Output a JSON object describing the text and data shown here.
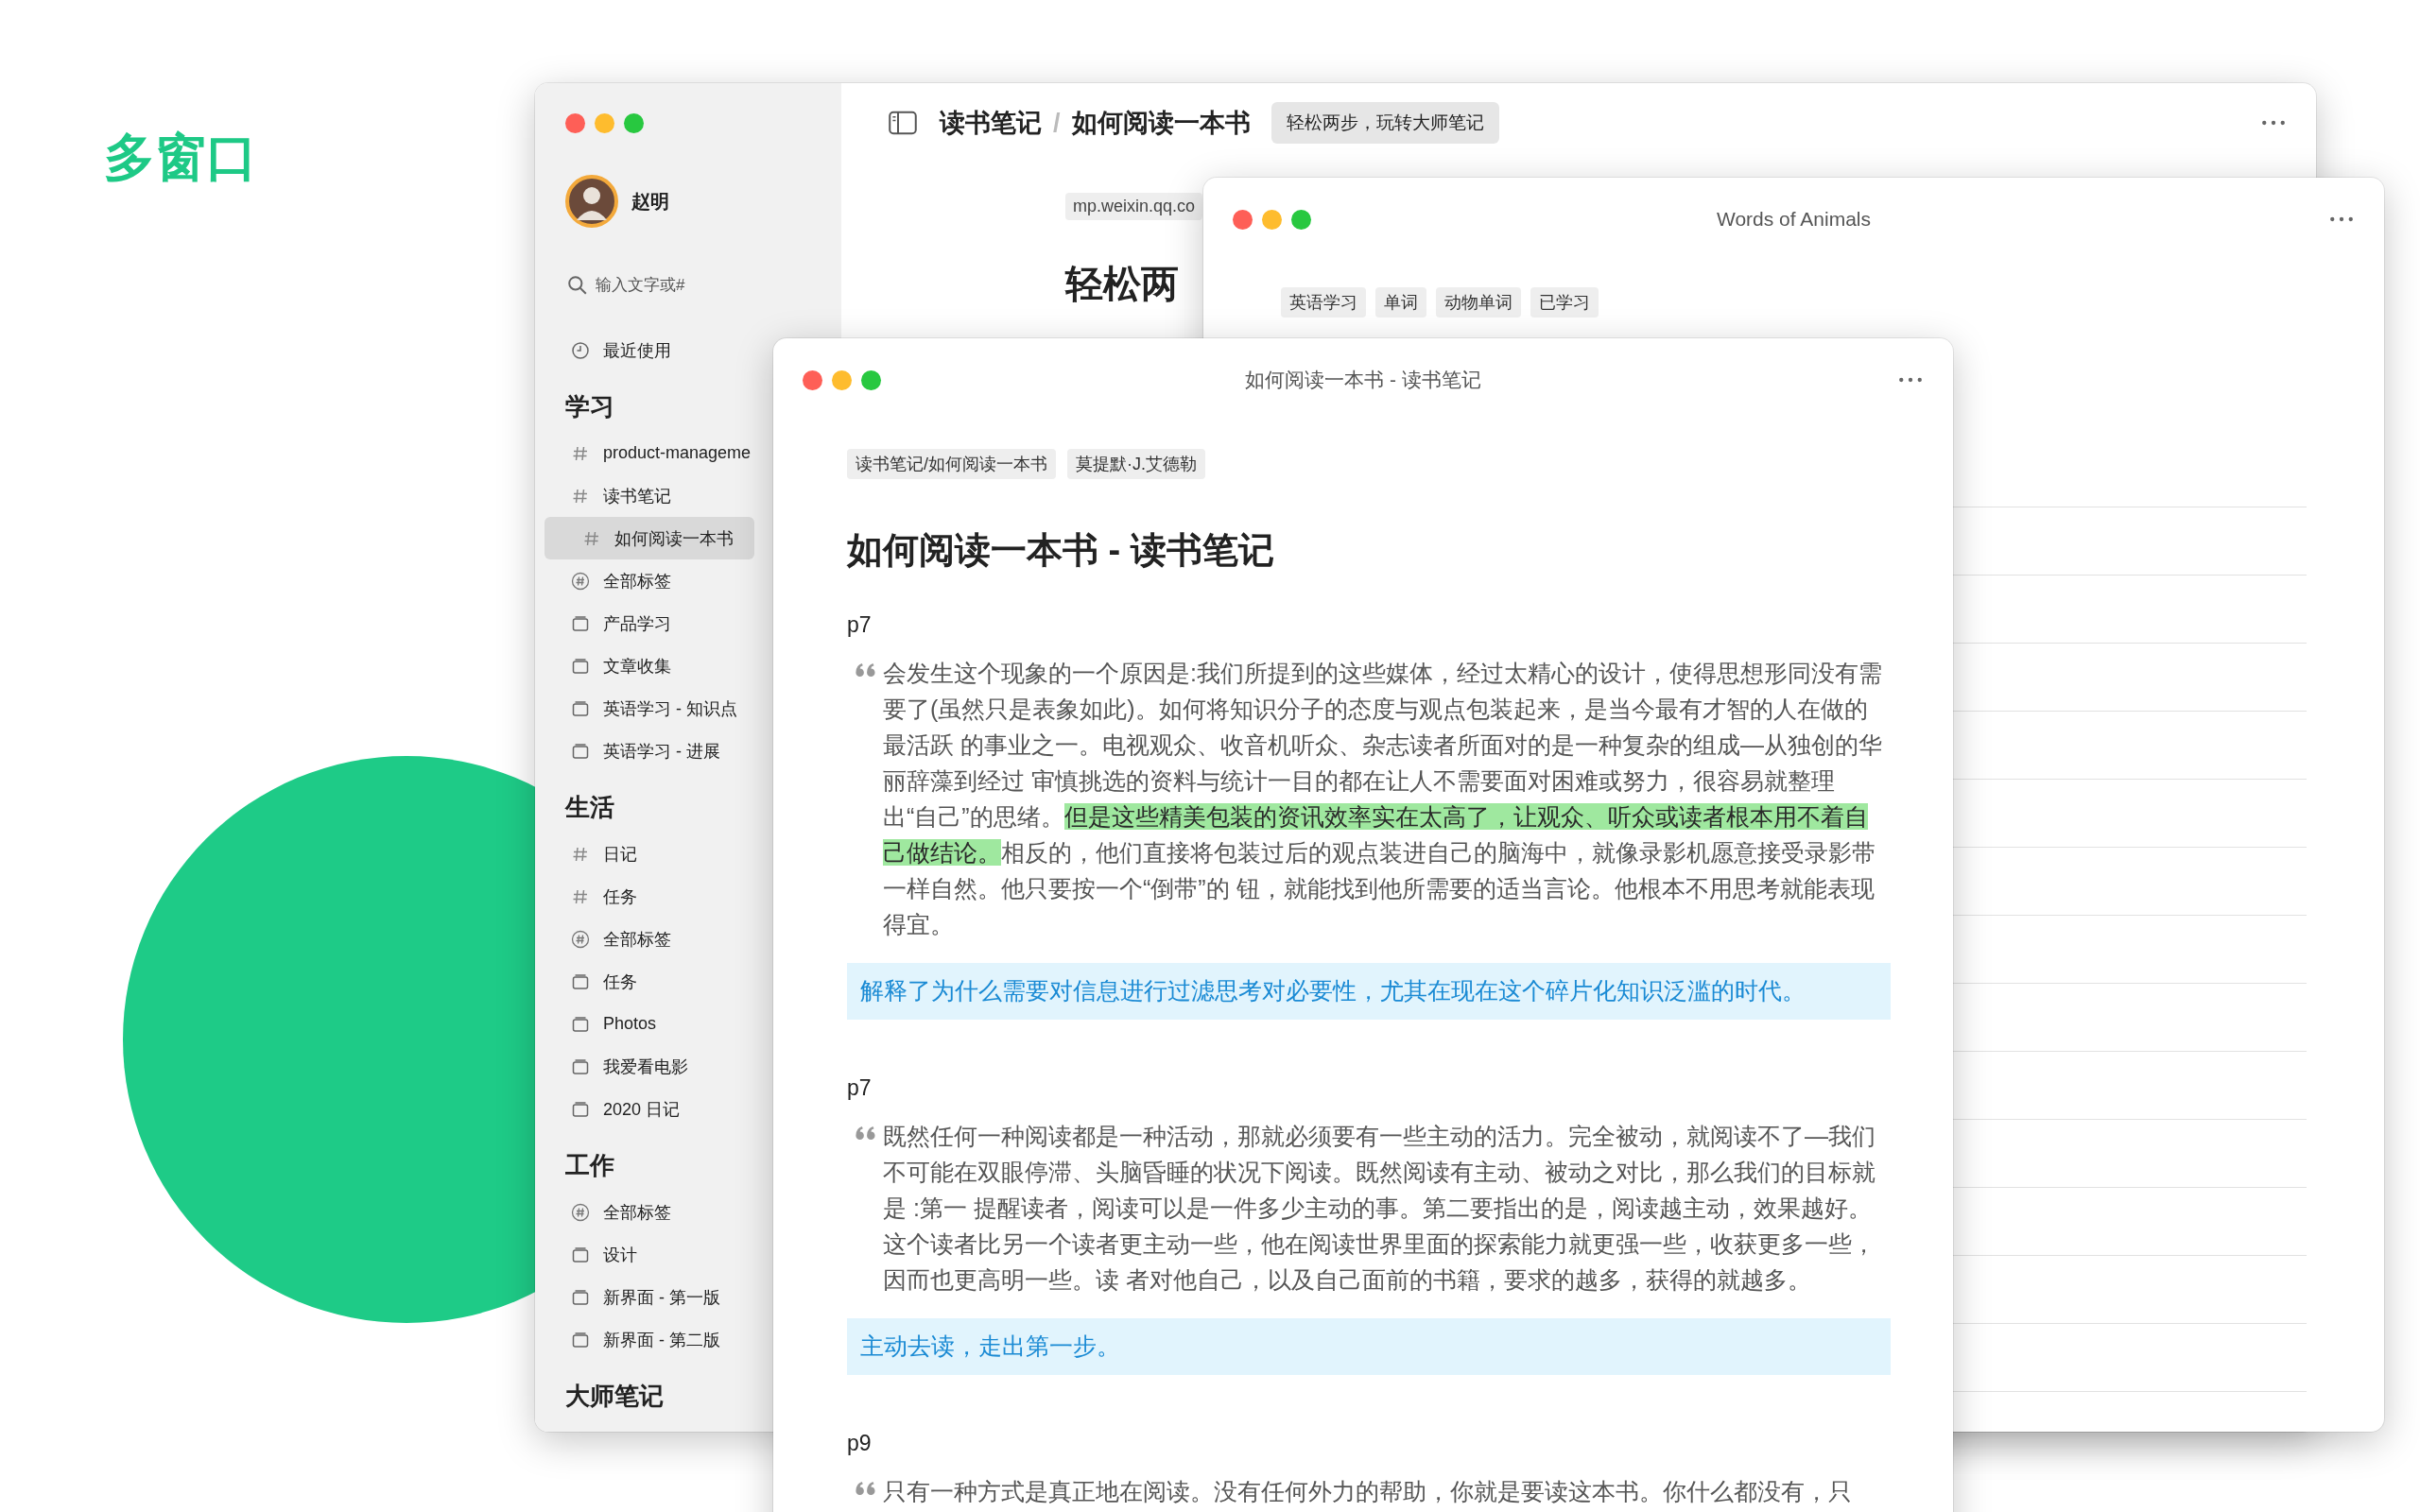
{
  "headline": "多窗口",
  "main_window": {
    "sidebar": {
      "user": "赵明",
      "search": {
        "placeholder": "输入文字或#"
      },
      "recent": "最近使用",
      "sections": [
        {
          "title": "学习",
          "items": [
            {
              "kind": "tag",
              "label": "product-manageme",
              "selected": false
            },
            {
              "kind": "tag",
              "label": "读书笔记",
              "selected": false,
              "children": [
                {
                  "kind": "tag",
                  "label": "如何阅读一本书",
                  "selected": true
                }
              ]
            },
            {
              "kind": "all-tags",
              "label": "全部标签",
              "selected": false
            },
            {
              "kind": "notebook",
              "label": "产品学习",
              "selected": false
            },
            {
              "kind": "notebook",
              "label": "文章收集",
              "selected": false
            },
            {
              "kind": "notebook",
              "label": "英语学习 -  知识点",
              "selected": false
            },
            {
              "kind": "notebook",
              "label": "英语学习 - 进展",
              "selected": false
            }
          ]
        },
        {
          "title": "生活",
          "items": [
            {
              "kind": "tag",
              "label": "日记",
              "selected": false
            },
            {
              "kind": "tag",
              "label": "任务",
              "selected": false
            },
            {
              "kind": "all-tags",
              "label": "全部标签",
              "selected": false
            },
            {
              "kind": "notebook",
              "label": "任务",
              "selected": false
            },
            {
              "kind": "notebook",
              "label": "Photos",
              "selected": false
            },
            {
              "kind": "notebook",
              "label": "我爱看电影",
              "selected": false
            },
            {
              "kind": "notebook",
              "label": "2020 日记",
              "selected": false
            }
          ]
        },
        {
          "title": "工作",
          "items": [
            {
              "kind": "all-tags",
              "label": "全部标签",
              "selected": false
            },
            {
              "kind": "notebook",
              "label": "设计",
              "selected": false
            },
            {
              "kind": "notebook",
              "label": "新界面 - 第一版",
              "selected": false
            },
            {
              "kind": "notebook",
              "label": "新界面 - 第二版",
              "selected": false
            }
          ]
        },
        {
          "title": "大师笔记"
        }
      ]
    },
    "toolbar": {
      "breadcrumb": {
        "parent": "读书笔记",
        "separator": "/",
        "current": "如何阅读一本书"
      },
      "tag": "轻松两步，玩转大师笔记"
    },
    "note": {
      "source": "mp.weixin.qq.co",
      "heading": "轻松两"
    }
  },
  "words_window": {
    "title": "Words of Animals",
    "tags": [
      "英语学习",
      "单词",
      "动物单词",
      "已学习"
    ]
  },
  "front_window": {
    "title": "如何阅读一本书 - 读书笔记",
    "tags": [
      "读书笔记/如何阅读一本书",
      "莫提默·J.艾德勒"
    ],
    "heading": "如何阅读一本书 - 读书笔记",
    "blocks": [
      {
        "kind": "page",
        "text": "p7"
      },
      {
        "kind": "quote",
        "segments": [
          {
            "text": "会发生这个现象的一个原因是:我们所提到的这些媒体，经过太精心的设计，使得思想形同没有需要了(虽然只是表象如此)。如何将知识分子的态度与观点包装起来，是当今最有才智的人在做的最活跃 的事业之一。电视观众、收音机听众、杂志读者所面对的是一种复杂的组成—从独创的华丽辞藻到经过 审慎挑选的资料与统计一目的都在让人不需要面对困难或努力，很容易就整理出“自己”的思绪。",
            "highlight": false
          },
          {
            "text": "但是这些精美包装的资讯效率实在太高了，让观众、听众或读者根本用不着自己做结论。",
            "highlight": true
          },
          {
            "text": "相反的，他们直接将包装过后的观点装进自己的脑海中，就像录影机愿意接受录影带一样自然。他只要按一个“倒带”的 钮，就能找到他所需要的适当言论。他根本不用思考就能表现得宜。",
            "highlight": false
          }
        ]
      },
      {
        "kind": "callout",
        "text": "解释了为什么需要对信息进行过滤思考对必要性，尤其在现在这个碎片化知识泛滥的时代。"
      },
      {
        "kind": "page",
        "text": "p7"
      },
      {
        "kind": "quote",
        "segments": [
          {
            "text": "既然任何一种阅读都是一种活动，那就必须要有一些主动的活力。完全被动，就阅读不了—我们不可能在双眼停滞、头脑昏睡的状况下阅读。既然阅读有主动、被动之对比，那么我们的目标就是 :第一 提醒读者，阅读可以是一件多少主动的事。第二要指出的是，阅读越主动，效果越好。这个读者比另一个读者更主动一些，他在阅读世界里面的探索能力就更强一些，收获更多一些，因而也更高明一些。读 者对他自己，以及自己面前的书籍，要求的越多，获得的就越多。",
            "highlight": false
          }
        ]
      },
      {
        "kind": "callout",
        "text": "主动去读，走出第一步。"
      },
      {
        "kind": "page",
        "text": "p9"
      },
      {
        "kind": "quote",
        "segments": [
          {
            "text": "只有一种方式是真正地在阅读。没有任何外力的帮助，你就是要读这本书。你什么都没有，只",
            "highlight": false
          }
        ]
      }
    ]
  }
}
